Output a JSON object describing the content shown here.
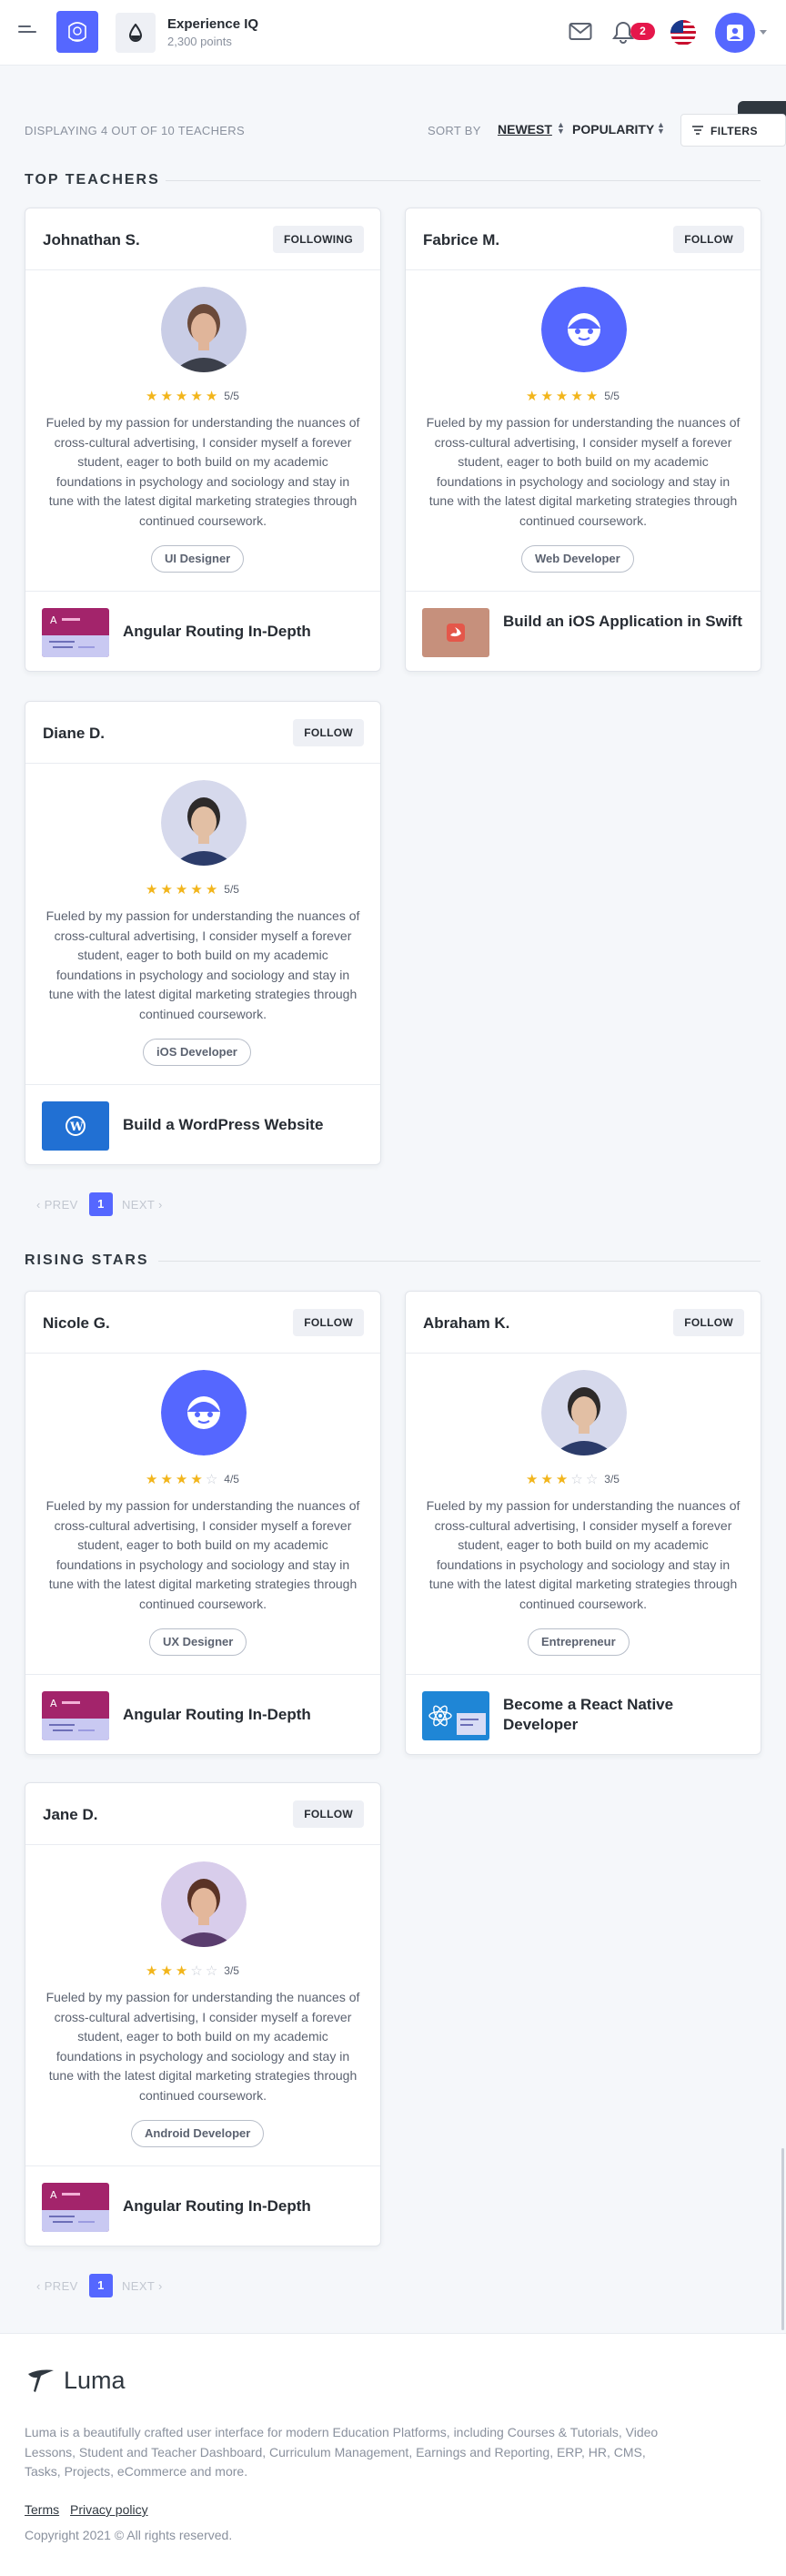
{
  "header": {
    "experience_title": "Experience IQ",
    "experience_points": "2,300 points",
    "notification_count": "2"
  },
  "listing": {
    "count_text": "DISPLAYING 4 OUT OF 10 TEACHERS",
    "sort_label": "SORT BY",
    "sort_newest": "NEWEST",
    "sort_popularity": "POPULARITY",
    "filter_label": "FILTERS"
  },
  "sections": {
    "top_teachers": "TOP TEACHERS",
    "rising_stars": "RISING STARS"
  },
  "bio_text": "Fueled by my passion for understanding the nuances of cross-cultural advertising, I consider myself a forever student, eager to both build on my academic foundations in psychology and sociology and stay in tune with the latest digital marketing strategies through continued coursework.",
  "top_teachers": [
    {
      "name": "Johnathan S.",
      "follow": "FOLLOWING",
      "rating": 5,
      "rating_text": "5/5",
      "role": "UI Designer",
      "course": "Angular Routing In-Depth",
      "course_icon": "angular-course-thumbnail",
      "avatar": "photo"
    },
    {
      "name": "Fabrice M.",
      "follow": "FOLLOW",
      "rating": 5,
      "rating_text": "5/5",
      "role": "Web Developer",
      "course": "Build an iOS Application in Swift",
      "course_icon": "swift-course-thumbnail",
      "avatar": "placeholder"
    },
    {
      "name": "Diane D.",
      "follow": "FOLLOW",
      "rating": 5,
      "rating_text": "5/5",
      "role": "iOS Developer",
      "course": "Build a WordPress Website",
      "course_icon": "wordpress-course-thumbnail",
      "avatar": "photo"
    }
  ],
  "rising_stars": [
    {
      "name": "Nicole G.",
      "follow": "FOLLOW",
      "rating": 4,
      "rating_text": "4/5",
      "role": "UX Designer",
      "course": "Angular Routing In-Depth",
      "course_icon": "angular-course-thumbnail",
      "avatar": "placeholder"
    },
    {
      "name": "Abraham K.",
      "follow": "FOLLOW",
      "rating": 3,
      "rating_text": "3/5",
      "role": "Entrepreneur",
      "course": "Become a React Native Developer",
      "course_icon": "react-course-thumbnail",
      "avatar": "photo"
    },
    {
      "name": "Jane D.",
      "follow": "FOLLOW",
      "rating": 3,
      "rating_text": "3/5",
      "role": "Android Developer",
      "course": "Angular Routing In-Depth",
      "course_icon": "angular-course-thumbnail",
      "avatar": "photo"
    }
  ],
  "pagination": {
    "prev": "‹ PREV",
    "page": "1",
    "next": "NEXT ›"
  },
  "footer": {
    "brand": "Luma",
    "description": "Luma is a beautifully crafted user interface for modern Education Platforms, including Courses & Tutorials, Video Lessons, Student and Teacher Dashboard, Curriculum Management, Earnings and Reporting, ERP, HR, CMS, Tasks, Projects, eCommerce and more.",
    "terms": "Terms",
    "privacy": "Privacy policy",
    "copyright": "Copyright 2021 © All rights reserved."
  },
  "colors": {
    "primary": "#5567ff",
    "star": "#f2b51b",
    "badge": "#e5174b",
    "dark": "#303840"
  }
}
